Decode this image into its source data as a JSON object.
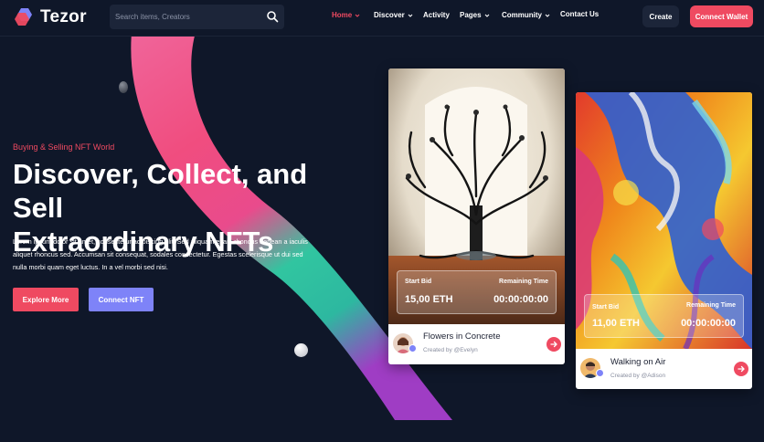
{
  "brand": {
    "name": "Tezor",
    "colors": {
      "accent": "#ef4a61",
      "secondary": "#7e83f8",
      "background": "#0f1729"
    }
  },
  "search": {
    "placeholder": "Search items, Creators",
    "icon": "search-icon"
  },
  "nav": {
    "items": [
      {
        "label": "Home",
        "active": true,
        "has_dropdown": true
      },
      {
        "label": "Discover",
        "active": false,
        "has_dropdown": true
      },
      {
        "label": "Activity",
        "active": false,
        "has_dropdown": false
      },
      {
        "label": "Pages",
        "active": false,
        "has_dropdown": true
      },
      {
        "label": "Community",
        "active": false,
        "has_dropdown": true
      },
      {
        "label": "Contact Us",
        "active": false,
        "has_dropdown": false
      }
    ],
    "create_label": "Create",
    "wallet_label": "Connect Wallet"
  },
  "hero": {
    "eyebrow": "Buying & Selling NFT World",
    "title_line1": "Discover, Collect, and Sell",
    "title_line2": "Extraordinary NFTs",
    "description": "Lorem ipsum dolor sit amet, consectetur adipiscing elit. Sed aliquam etiam rhoncus aenean a iaculis aliquet rhoncus sed. Accumsan sit consequat, sodales consectetur. Egestas scelerisque ut dui sed nulla morbi quam eget luctus. In a vel morbi sed nisi.",
    "explore_label": "Explore More",
    "connect_label": "Connect NFT"
  },
  "cards": [
    {
      "start_bid_label": "Start Bid",
      "start_bid_value": "15,00 ETH",
      "remaining_label": "Remaining Time",
      "remaining_value": "00:00:00:00",
      "name": "Flowers in Concrete",
      "creator": "Created by @Evelyn"
    },
    {
      "start_bid_label": "Start Bid",
      "start_bid_value": "11,00 ETH",
      "remaining_label": "Remaining Time",
      "remaining_value": "00:00:00:00",
      "name": "Walking on Air",
      "creator": "Created by @Adison"
    }
  ]
}
